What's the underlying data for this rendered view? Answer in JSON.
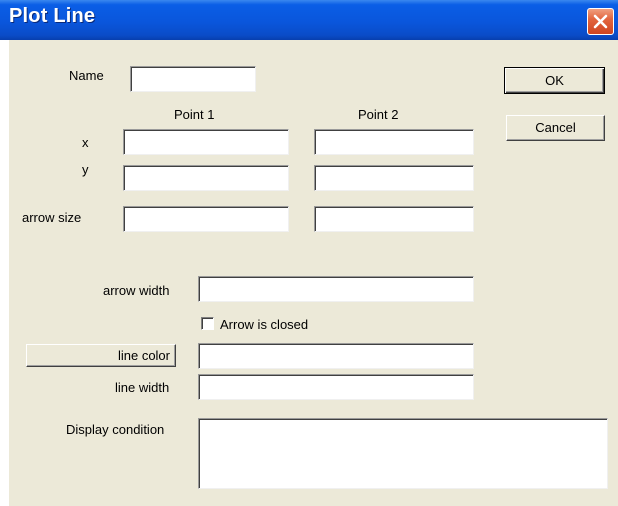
{
  "window": {
    "title": "Plot Line"
  },
  "buttons": {
    "ok": "OK",
    "cancel": "Cancel",
    "line_color": "line color"
  },
  "labels": {
    "name": "Name",
    "point1": "Point 1",
    "point2": "Point 2",
    "x": "x",
    "y": "y",
    "arrow_size": "arrow size",
    "arrow_width": "arrow width",
    "arrow_closed": "Arrow is closed",
    "line_width": "line width",
    "display_condition": "Display condition"
  },
  "fields": {
    "name": "",
    "p1_x": "",
    "p2_x": "",
    "p1_y": "",
    "p2_y": "",
    "p1_arrow_size": "",
    "p2_arrow_size": "",
    "arrow_width": "",
    "line_color": "",
    "line_width": "",
    "display_condition": ""
  },
  "checkbox": {
    "arrow_closed": false
  },
  "colors": {
    "titlebar": "#0a56dc",
    "dialog_bg": "#ece9d8",
    "close_button": "#e2653f"
  }
}
